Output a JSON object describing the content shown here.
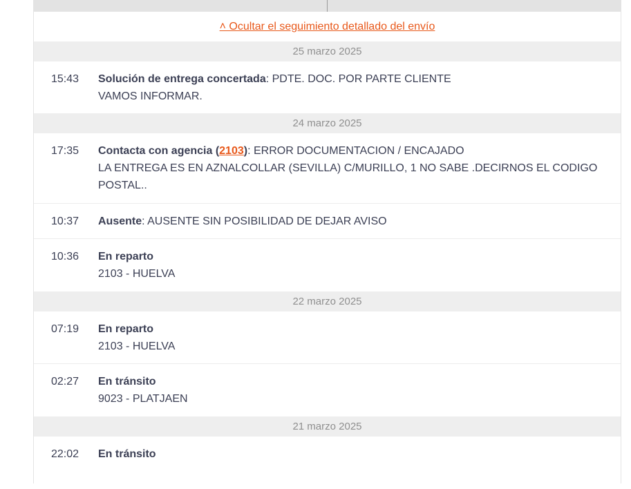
{
  "toggle": {
    "label": "˄ Ocultar el seguimiento detallado del envío"
  },
  "groups": [
    {
      "date": "25 marzo 2025",
      "events": [
        {
          "time": "15:43",
          "title": "Solución de entrega concertada",
          "detail": ": PDTE. DOC. POR PARTE CLIENTE",
          "line2": "VAMOS INFORMAR."
        }
      ]
    },
    {
      "date": "24 marzo 2025",
      "events": [
        {
          "time": "17:35",
          "title_pre": "Contacta con agencia (",
          "agency": "2103",
          "title_post": ")",
          "detail": ": ERROR DOCUMENTACION / ENCAJADO",
          "line2": "LA ENTREGA ES EN AZNALCOLLAR (SEVILLA) C/MURILLO, 1 NO SABE .DECIRNOS EL CODIGO POSTAL.."
        },
        {
          "time": "10:37",
          "title": "Ausente",
          "detail": ": AUSENTE SIN POSIBILIDAD DE DEJAR AVISO"
        },
        {
          "time": "10:36",
          "title": "En reparto",
          "line2": "2103 - HUELVA"
        }
      ]
    },
    {
      "date": "22 marzo 2025",
      "events": [
        {
          "time": "07:19",
          "title": "En reparto",
          "line2": "2103 - HUELVA"
        },
        {
          "time": "02:27",
          "title": "En tránsito",
          "line2": "9023 - PLATJAEN"
        }
      ]
    },
    {
      "date": "21 marzo 2025",
      "events": [
        {
          "time": "22:02",
          "title": "En tránsito"
        }
      ]
    }
  ],
  "colors": {
    "accent": "#e8581a",
    "text": "#3b3f54",
    "date_bg": "#eeeeee",
    "date_text": "#8f8f8f"
  }
}
